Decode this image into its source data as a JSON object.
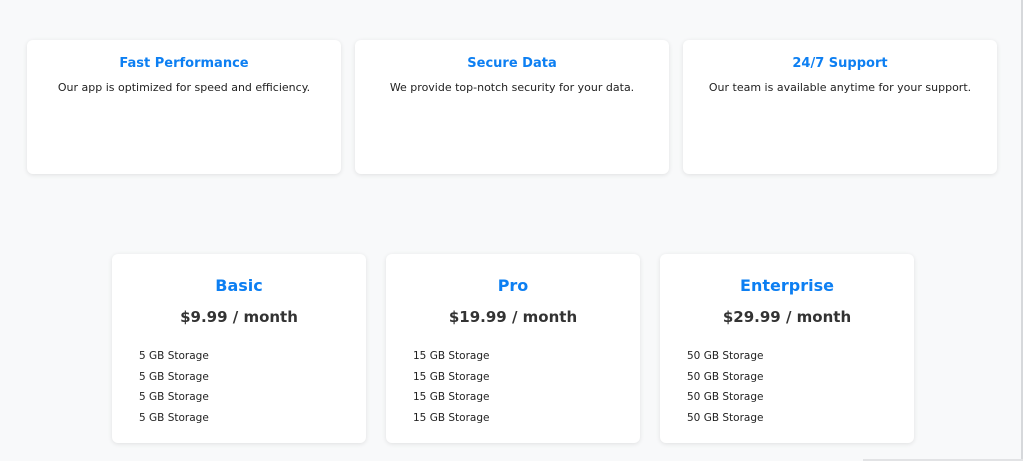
{
  "features": [
    {
      "title": "Fast Performance",
      "description": "Our app is optimized for speed and efficiency."
    },
    {
      "title": "Secure Data",
      "description": "We provide top-notch security for your data."
    },
    {
      "title": "24/7 Support",
      "description": "Our team is available anytime for your support."
    }
  ],
  "plans": [
    {
      "name": "Basic",
      "price": "$9.99 / month",
      "items": [
        "5 GB Storage",
        "5 GB Storage",
        "5 GB Storage",
        "5 GB Storage"
      ]
    },
    {
      "name": "Pro",
      "price": "$19.99 / month",
      "items": [
        "15 GB Storage",
        "15 GB Storage",
        "15 GB Storage",
        "15 GB Storage"
      ]
    },
    {
      "name": "Enterprise",
      "price": "$29.99 / month",
      "items": [
        "50 GB Storage",
        "50 GB Storage",
        "50 GB Storage",
        "50 GB Storage"
      ]
    }
  ],
  "colors": {
    "accent": "#0d7ff2",
    "background": "#f8f9fa",
    "card": "#ffffff",
    "text": "#333333"
  }
}
